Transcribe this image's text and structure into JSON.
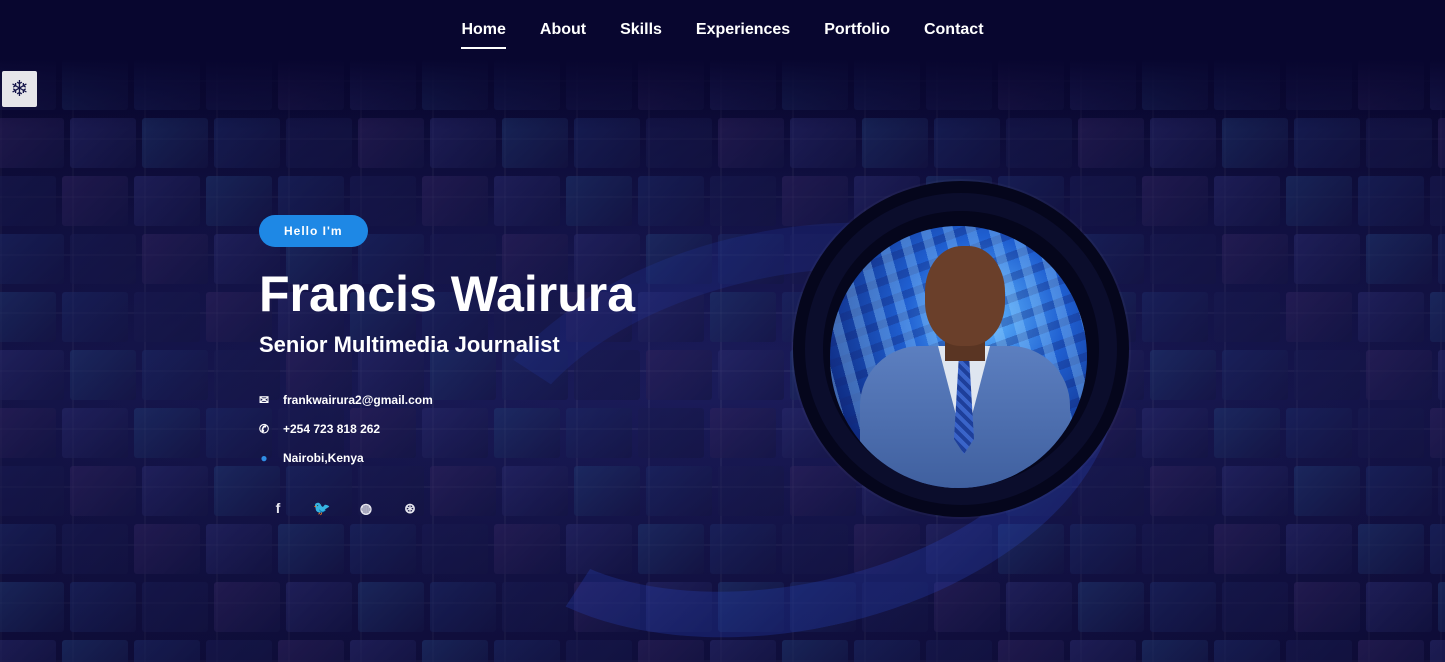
{
  "nav": {
    "items": [
      {
        "label": "Home",
        "active": true
      },
      {
        "label": "About",
        "active": false
      },
      {
        "label": "Skills",
        "active": false
      },
      {
        "label": "Experiences",
        "active": false
      },
      {
        "label": "Portfolio",
        "active": false
      },
      {
        "label": "Contact",
        "active": false
      }
    ]
  },
  "theme_toggle": {
    "icon": "snowflake-icon",
    "glyph": "❄"
  },
  "hero": {
    "badge": "Hello I'm",
    "name": "Francis Wairura",
    "title": "Senior Multimedia Journalist",
    "email": "frankwairura2@gmail.com",
    "phone": "+254 723 818 262",
    "location": "Nairobi,Kenya"
  },
  "social": [
    {
      "icon": "facebook-icon",
      "glyph": "f"
    },
    {
      "icon": "twitter-icon",
      "glyph": "🐦"
    },
    {
      "icon": "github-icon",
      "glyph": "◍"
    },
    {
      "icon": "dribbble-icon",
      "glyph": "⊛"
    }
  ],
  "colors": {
    "background": "#0a0838",
    "accent": "#1e88e5",
    "text": "#ffffff"
  }
}
